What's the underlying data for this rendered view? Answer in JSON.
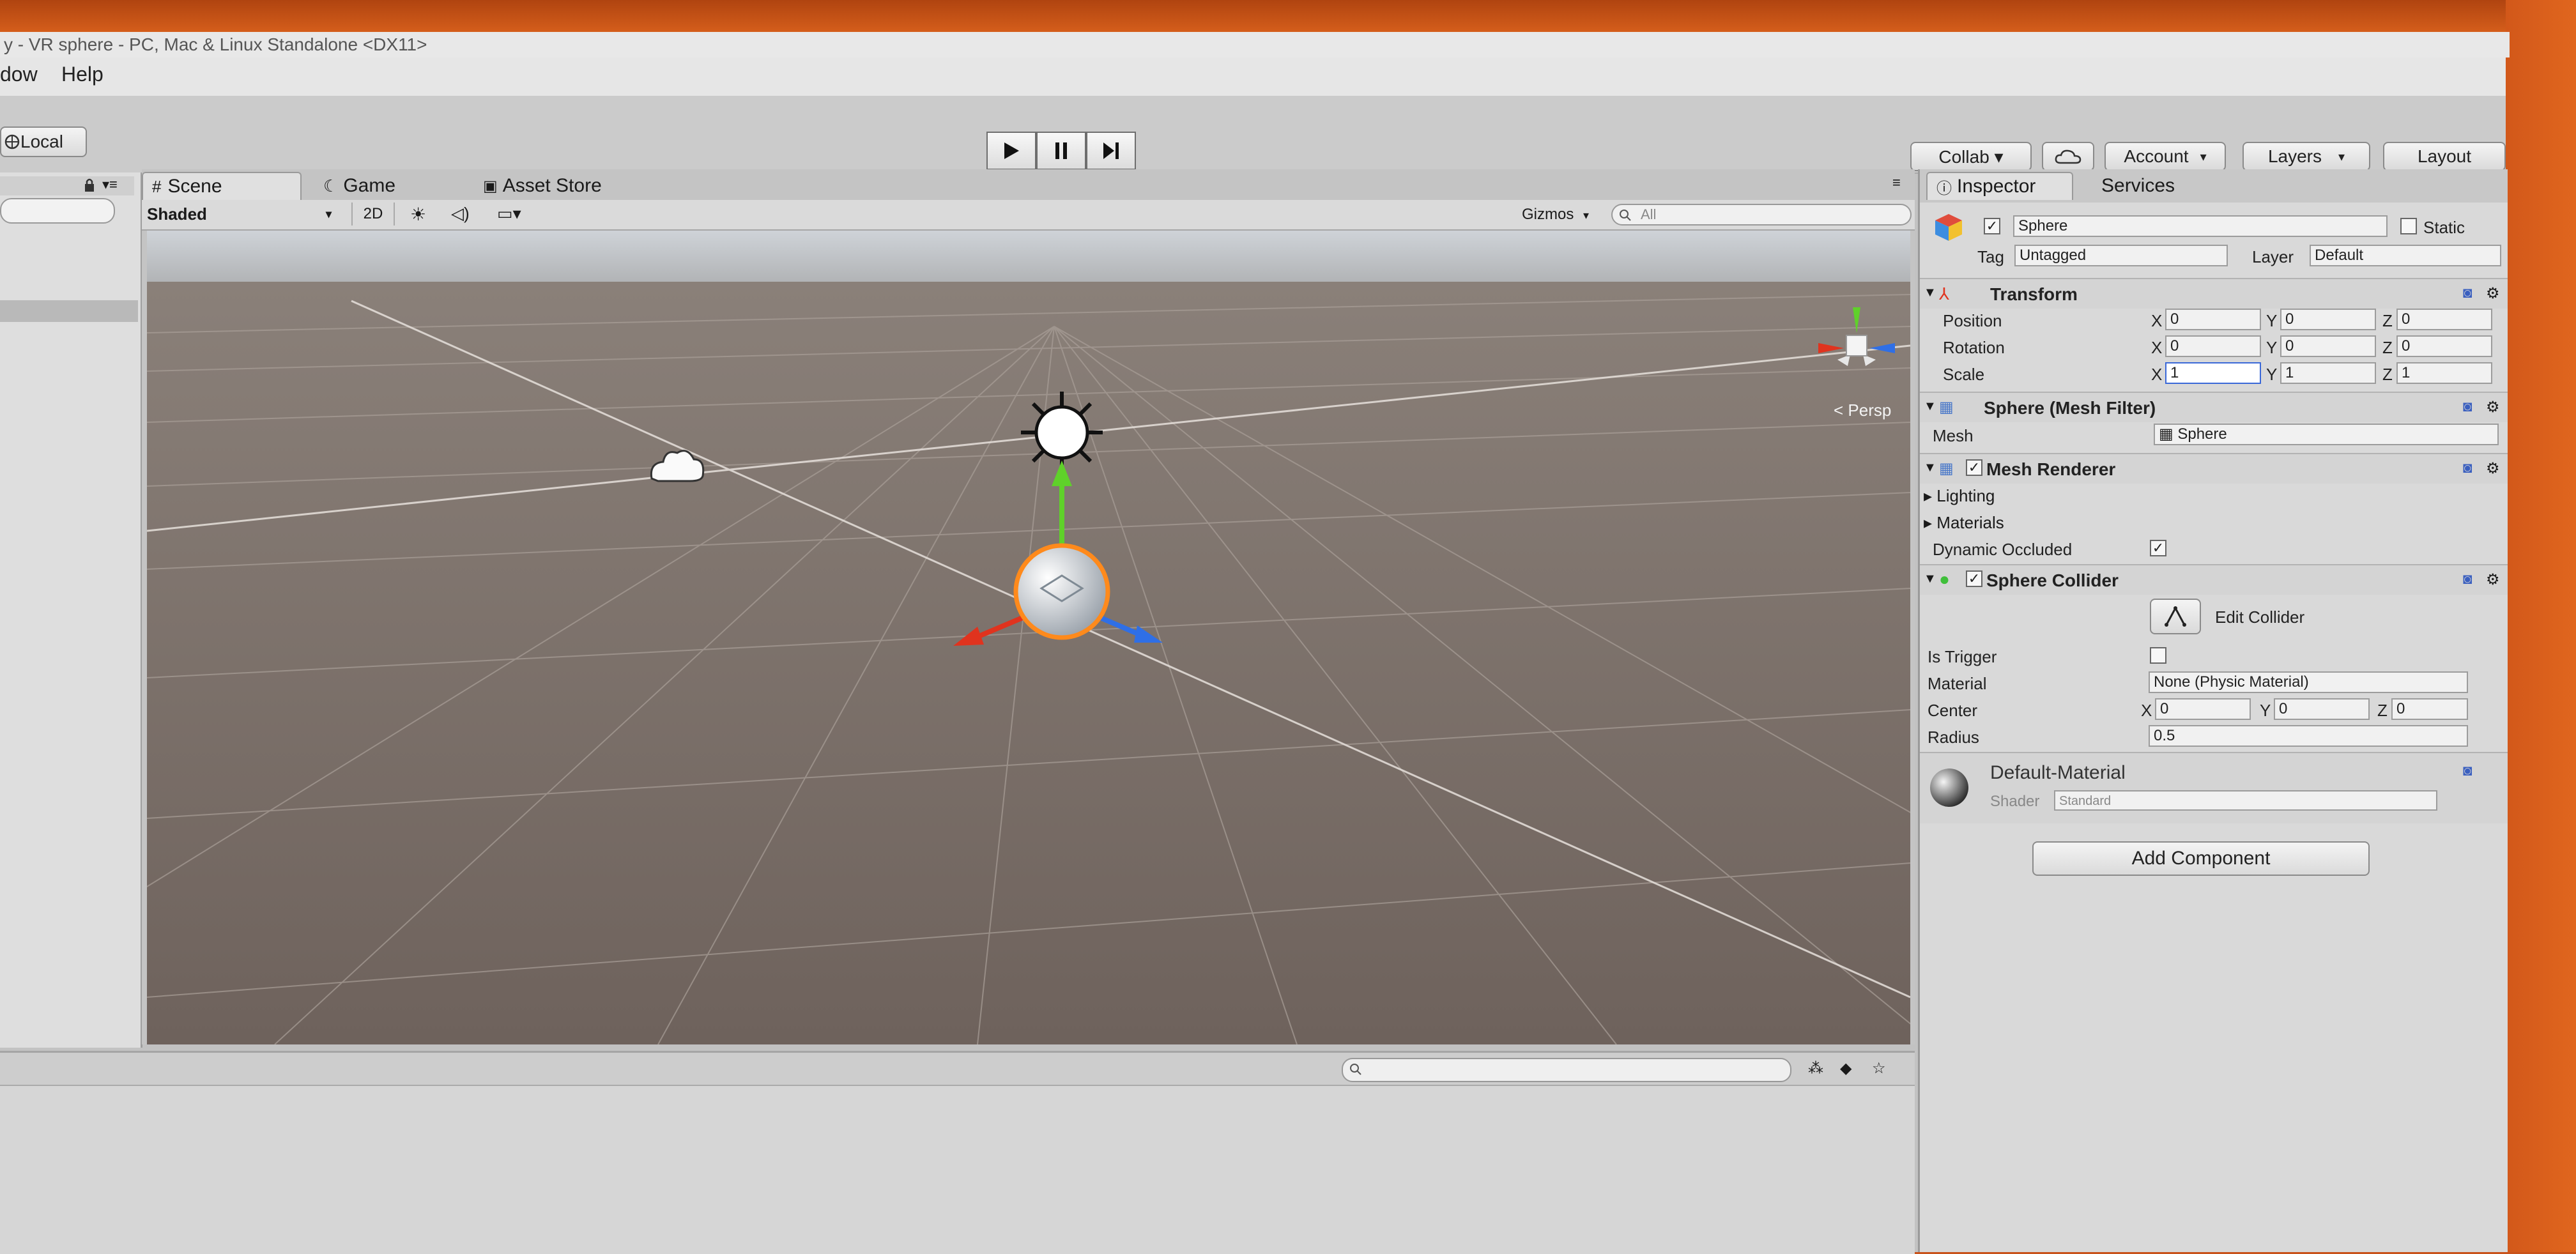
{
  "window": {
    "title": "y - VR sphere - PC, Mac & Linux Standalone <DX11>"
  },
  "menu": {
    "items": [
      "dow",
      "Help"
    ]
  },
  "toolbar": {
    "local_label": "Local",
    "collab_label": "Collab ▾",
    "account_label": "Account",
    "layers_label": "Layers",
    "layout_label": "Layout"
  },
  "scene": {
    "tabs": [
      "Scene",
      "Game",
      "Asset Store"
    ],
    "shading_mode": "Shaded",
    "mode_2d": "2D",
    "gizmos_label": "Gizmos",
    "search_placeholder": "All",
    "persp_label": "< Persp"
  },
  "inspector": {
    "tabs": [
      "Inspector",
      "Services"
    ],
    "object_name": "Sphere",
    "static_label": "Static",
    "tag_label": "Tag",
    "tag_value": "Untagged",
    "layer_label": "Layer",
    "layer_value": "Default",
    "transform": {
      "title": "Transform",
      "position_label": "Position",
      "rotation_label": "Rotation",
      "scale_label": "Scale",
      "position": {
        "x": "0",
        "y": "0",
        "z": "0"
      },
      "rotation": {
        "x": "0",
        "y": "0",
        "z": "0"
      },
      "scale": {
        "x": "1",
        "y": "1",
        "z": "1"
      }
    },
    "mesh_filter": {
      "title": "Sphere (Mesh Filter)",
      "mesh_label": "Mesh",
      "mesh_value": "Sphere"
    },
    "mesh_renderer": {
      "title": "Mesh Renderer",
      "lighting_label": "Lighting",
      "materials_label": "Materials",
      "dynamic_occluded_label": "Dynamic Occluded"
    },
    "sphere_collider": {
      "title": "Sphere Collider",
      "edit_collider_label": "Edit Collider",
      "is_trigger_label": "Is Trigger",
      "material_label": "Material",
      "material_value": "None (Physic Material)",
      "center_label": "Center",
      "center": {
        "x": "0",
        "y": "0",
        "z": "0"
      },
      "radius_label": "Radius",
      "radius_value": "0.5"
    },
    "material": {
      "name": "Default-Material",
      "shader_label": "Shader",
      "shader_value": "Standard"
    },
    "add_component_label": "Add Component",
    "axis": {
      "x": "X",
      "y": "Y",
      "z": "Z"
    }
  },
  "colors": {
    "monitor_frame": "#c8521a",
    "viewport_ground": "#7b6f69",
    "axis_x": "#e0331e",
    "axis_y": "#5fd12a",
    "axis_z": "#2f6fe6",
    "selection": "#ff8a1c"
  },
  "icons": [
    "cloud-icon",
    "play-icon",
    "pause-icon",
    "step-icon",
    "lock-icon",
    "scene-gizmo-icon",
    "directional-light-icon",
    "camera-icon",
    "search-icon"
  ]
}
